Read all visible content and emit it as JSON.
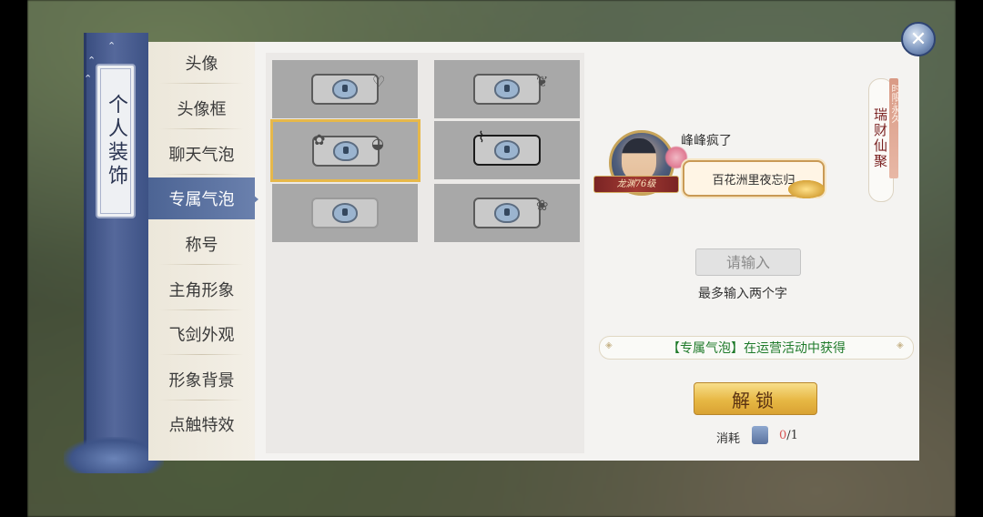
{
  "title": "个人装饰",
  "categories": [
    {
      "label": "头像"
    },
    {
      "label": "头像框"
    },
    {
      "label": "聊天气泡"
    },
    {
      "label": "专属气泡",
      "active": true
    },
    {
      "label": "称号"
    },
    {
      "label": "主角形象"
    },
    {
      "label": "飞剑外观"
    },
    {
      "label": "形象背景"
    },
    {
      "label": "点触特效"
    }
  ],
  "bubble_grid": {
    "items": 6,
    "selected_index": 2
  },
  "preview": {
    "level_badge": "龙渊76级",
    "player_name": "峰峰疯了",
    "bubble_text": "百花洲里夜忘归"
  },
  "side_tag": {
    "time_label": "时限:永久",
    "bubble_name": "瑞财仙聚"
  },
  "input": {
    "placeholder": "请输入",
    "hint": "最多输入两个字"
  },
  "source_text": "【专属气泡】在运营活动中获得",
  "unlock_label": "解锁",
  "cost": {
    "label": "消耗",
    "have": "0",
    "separator": "/",
    "need": "1"
  },
  "close_symbol": "✕",
  "colors": {
    "accent_gold": "#e7b844",
    "selected_border": "#e7b84a",
    "source_green": "#1e7a2a",
    "cost_red": "#d95757",
    "active_tab": "#4c6494"
  }
}
